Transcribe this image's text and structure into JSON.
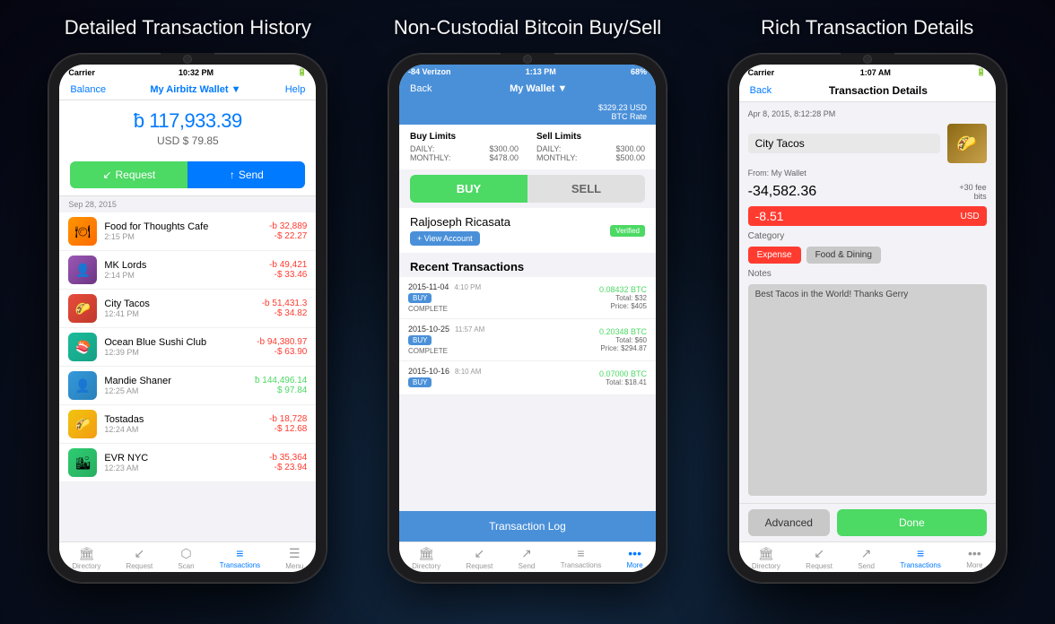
{
  "titles": {
    "left": "Detailed Transaction History",
    "center": "Non-Custodial Bitcoin Buy/Sell",
    "right": "Rich Transaction Details"
  },
  "phone1": {
    "statusBar": {
      "carrier": "Carrier",
      "time": "10:32 PM",
      "battery": "■■■■"
    },
    "nav": {
      "left": "Balance",
      "title": "My Airbitz Wallet ▼",
      "right": "Help"
    },
    "balance": {
      "btc": "ƀ 117,933.39",
      "usd": "USD $ 79.85"
    },
    "buttons": {
      "request": "Request",
      "send": "Send"
    },
    "dateHeader": "Sep 28, 2015",
    "transactions": [
      {
        "name": "Food for Thoughts Cafe",
        "time": "2:15 PM",
        "btc": "-b 32,889",
        "usd": "-$ 22.27",
        "color": "orange"
      },
      {
        "name": "MK Lords",
        "time": "2:14 PM",
        "btc": "-b 49,421",
        "usd": "-$ 33.46",
        "color": "purple"
      },
      {
        "name": "City Tacos",
        "time": "12:41 PM",
        "btc": "-b 51,431.3",
        "usd": "-$ 34.82",
        "color": "red"
      },
      {
        "name": "Ocean Blue Sushi Club",
        "time": "12:39 PM",
        "btc": "-b 94,380.97",
        "usd": "-$ 63.90",
        "color": "teal"
      },
      {
        "name": "Mandie Shaner",
        "time": "12:25 AM",
        "btc": "ƀ 144,496.14",
        "usd": "$ 97.84",
        "color": "blue",
        "positive": true
      },
      {
        "name": "Tostadas",
        "time": "12:24 AM",
        "btc": "-b 18,728",
        "usd": "-$ 12.68",
        "color": "yellow"
      },
      {
        "name": "EVR NYC",
        "time": "12:23 AM",
        "btc": "-b 35,364",
        "usd": "-$ 23.94",
        "color": "green"
      }
    ],
    "bottomNav": [
      {
        "label": "Directory",
        "icon": "🏛"
      },
      {
        "label": "Request",
        "icon": "↙"
      },
      {
        "label": "Scan",
        "icon": "⬡"
      },
      {
        "label": "Transactions",
        "icon": "≡",
        "active": true
      },
      {
        "label": "Menu",
        "icon": "☰"
      }
    ]
  },
  "phone2": {
    "statusBar": {
      "carrier": "-84 Verizon",
      "time": "1:13 PM",
      "battery": "68%"
    },
    "nav": {
      "back": "Back",
      "title": "My Wallet ▼"
    },
    "banner": "$329.23 USD\nBTC Rate",
    "buyLimits": {
      "title": "Buy Limits",
      "daily": {
        "label": "DAILY:",
        "value": "$300.00"
      },
      "monthly": {
        "label": "MONTHLY:",
        "value": "$478.00"
      }
    },
    "sellLimits": {
      "title": "Sell Limits",
      "daily": {
        "label": "DAILY:",
        "value": "$300.00"
      },
      "monthly": {
        "label": "MONTHLY:",
        "value": "$500.00"
      }
    },
    "tabs": {
      "buy": "BUY",
      "sell": "SELL"
    },
    "user": {
      "name": "Raljoseph Ricasata",
      "viewAccount": "+ View Account",
      "verified": "Verified"
    },
    "recentTitle": "Recent Transactions",
    "transactions": [
      {
        "date": "2015-11-04",
        "time": "4:10 PM",
        "type": "BUY",
        "status": "COMPLETE",
        "btc": "0.08432 BTC",
        "total": "Total: $32",
        "price": "Price: $405"
      },
      {
        "date": "2015-10-25",
        "time": "11:57 AM",
        "type": "BUY",
        "status": "COMPLETE",
        "btc": "0.20348 BTC",
        "total": "Total: $60",
        "price": "Price: $294.87"
      },
      {
        "date": "2015-10-16",
        "time": "8:10 AM",
        "type": "BUY",
        "status": "",
        "btc": "0.07000 BTC",
        "total": "Total: $18.41",
        "price": ""
      }
    ],
    "bottomBtn": "Transaction Log",
    "bottomNav": [
      {
        "label": "Directory",
        "icon": "🏛"
      },
      {
        "label": "Request",
        "icon": "↙"
      },
      {
        "label": "Send",
        "icon": "↗"
      },
      {
        "label": "Transactions",
        "icon": "≡"
      },
      {
        "label": "More",
        "icon": "•••",
        "active": true
      }
    ]
  },
  "phone3": {
    "statusBar": {
      "carrier": "Carrier",
      "time": "1:07 AM",
      "battery": "■■■■■"
    },
    "nav": {
      "back": "Back",
      "title": "Transaction Details"
    },
    "date": "Apr 8, 2015, 8:12:28 PM",
    "merchant": "City Tacos",
    "from": "From: My Wallet",
    "btcAmount": "-34,582.36",
    "fee": "+30 fee\nbits",
    "usdAmount": "-8.51",
    "usdLabel": "USD",
    "categoryLabel": "Category",
    "categories": {
      "expense": "Expense",
      "food": "Food & Dining"
    },
    "notesLabel": "Notes",
    "notes": "Best Tacos in the World!  Thanks Gerry",
    "buttons": {
      "advanced": "Advanced",
      "done": "Done"
    },
    "bottomNav": [
      {
        "label": "Directory",
        "icon": "🏛"
      },
      {
        "label": "Request",
        "icon": "↙"
      },
      {
        "label": "Send",
        "icon": "↗"
      },
      {
        "label": "Transactions",
        "icon": "≡",
        "active": true
      },
      {
        "label": "More",
        "icon": "•••"
      }
    ]
  }
}
